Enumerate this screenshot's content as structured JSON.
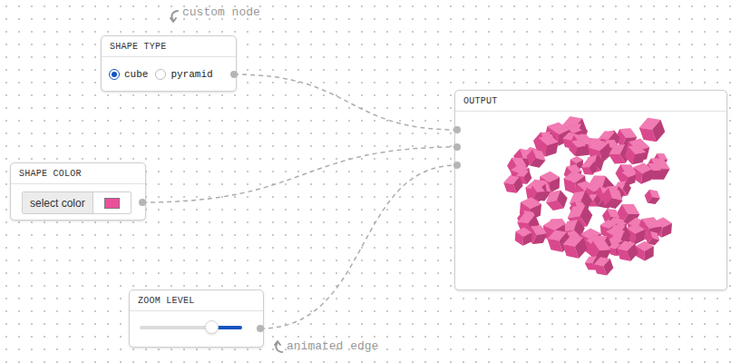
{
  "nodes": {
    "shape_type": {
      "title": "SHAPE TYPE",
      "options": [
        {
          "label": "cube",
          "selected": true
        },
        {
          "label": "pyramid",
          "selected": false
        }
      ]
    },
    "shape_color": {
      "title": "SHAPE COLOR",
      "button": "select color",
      "color": "#ec4f9a"
    },
    "zoom_level": {
      "title": "ZOOM LEVEL",
      "level": 0.7
    },
    "output": {
      "title": "OUTPUT"
    }
  },
  "annotations": {
    "custom_node": "custom node",
    "animated_edge": "animated edge"
  }
}
